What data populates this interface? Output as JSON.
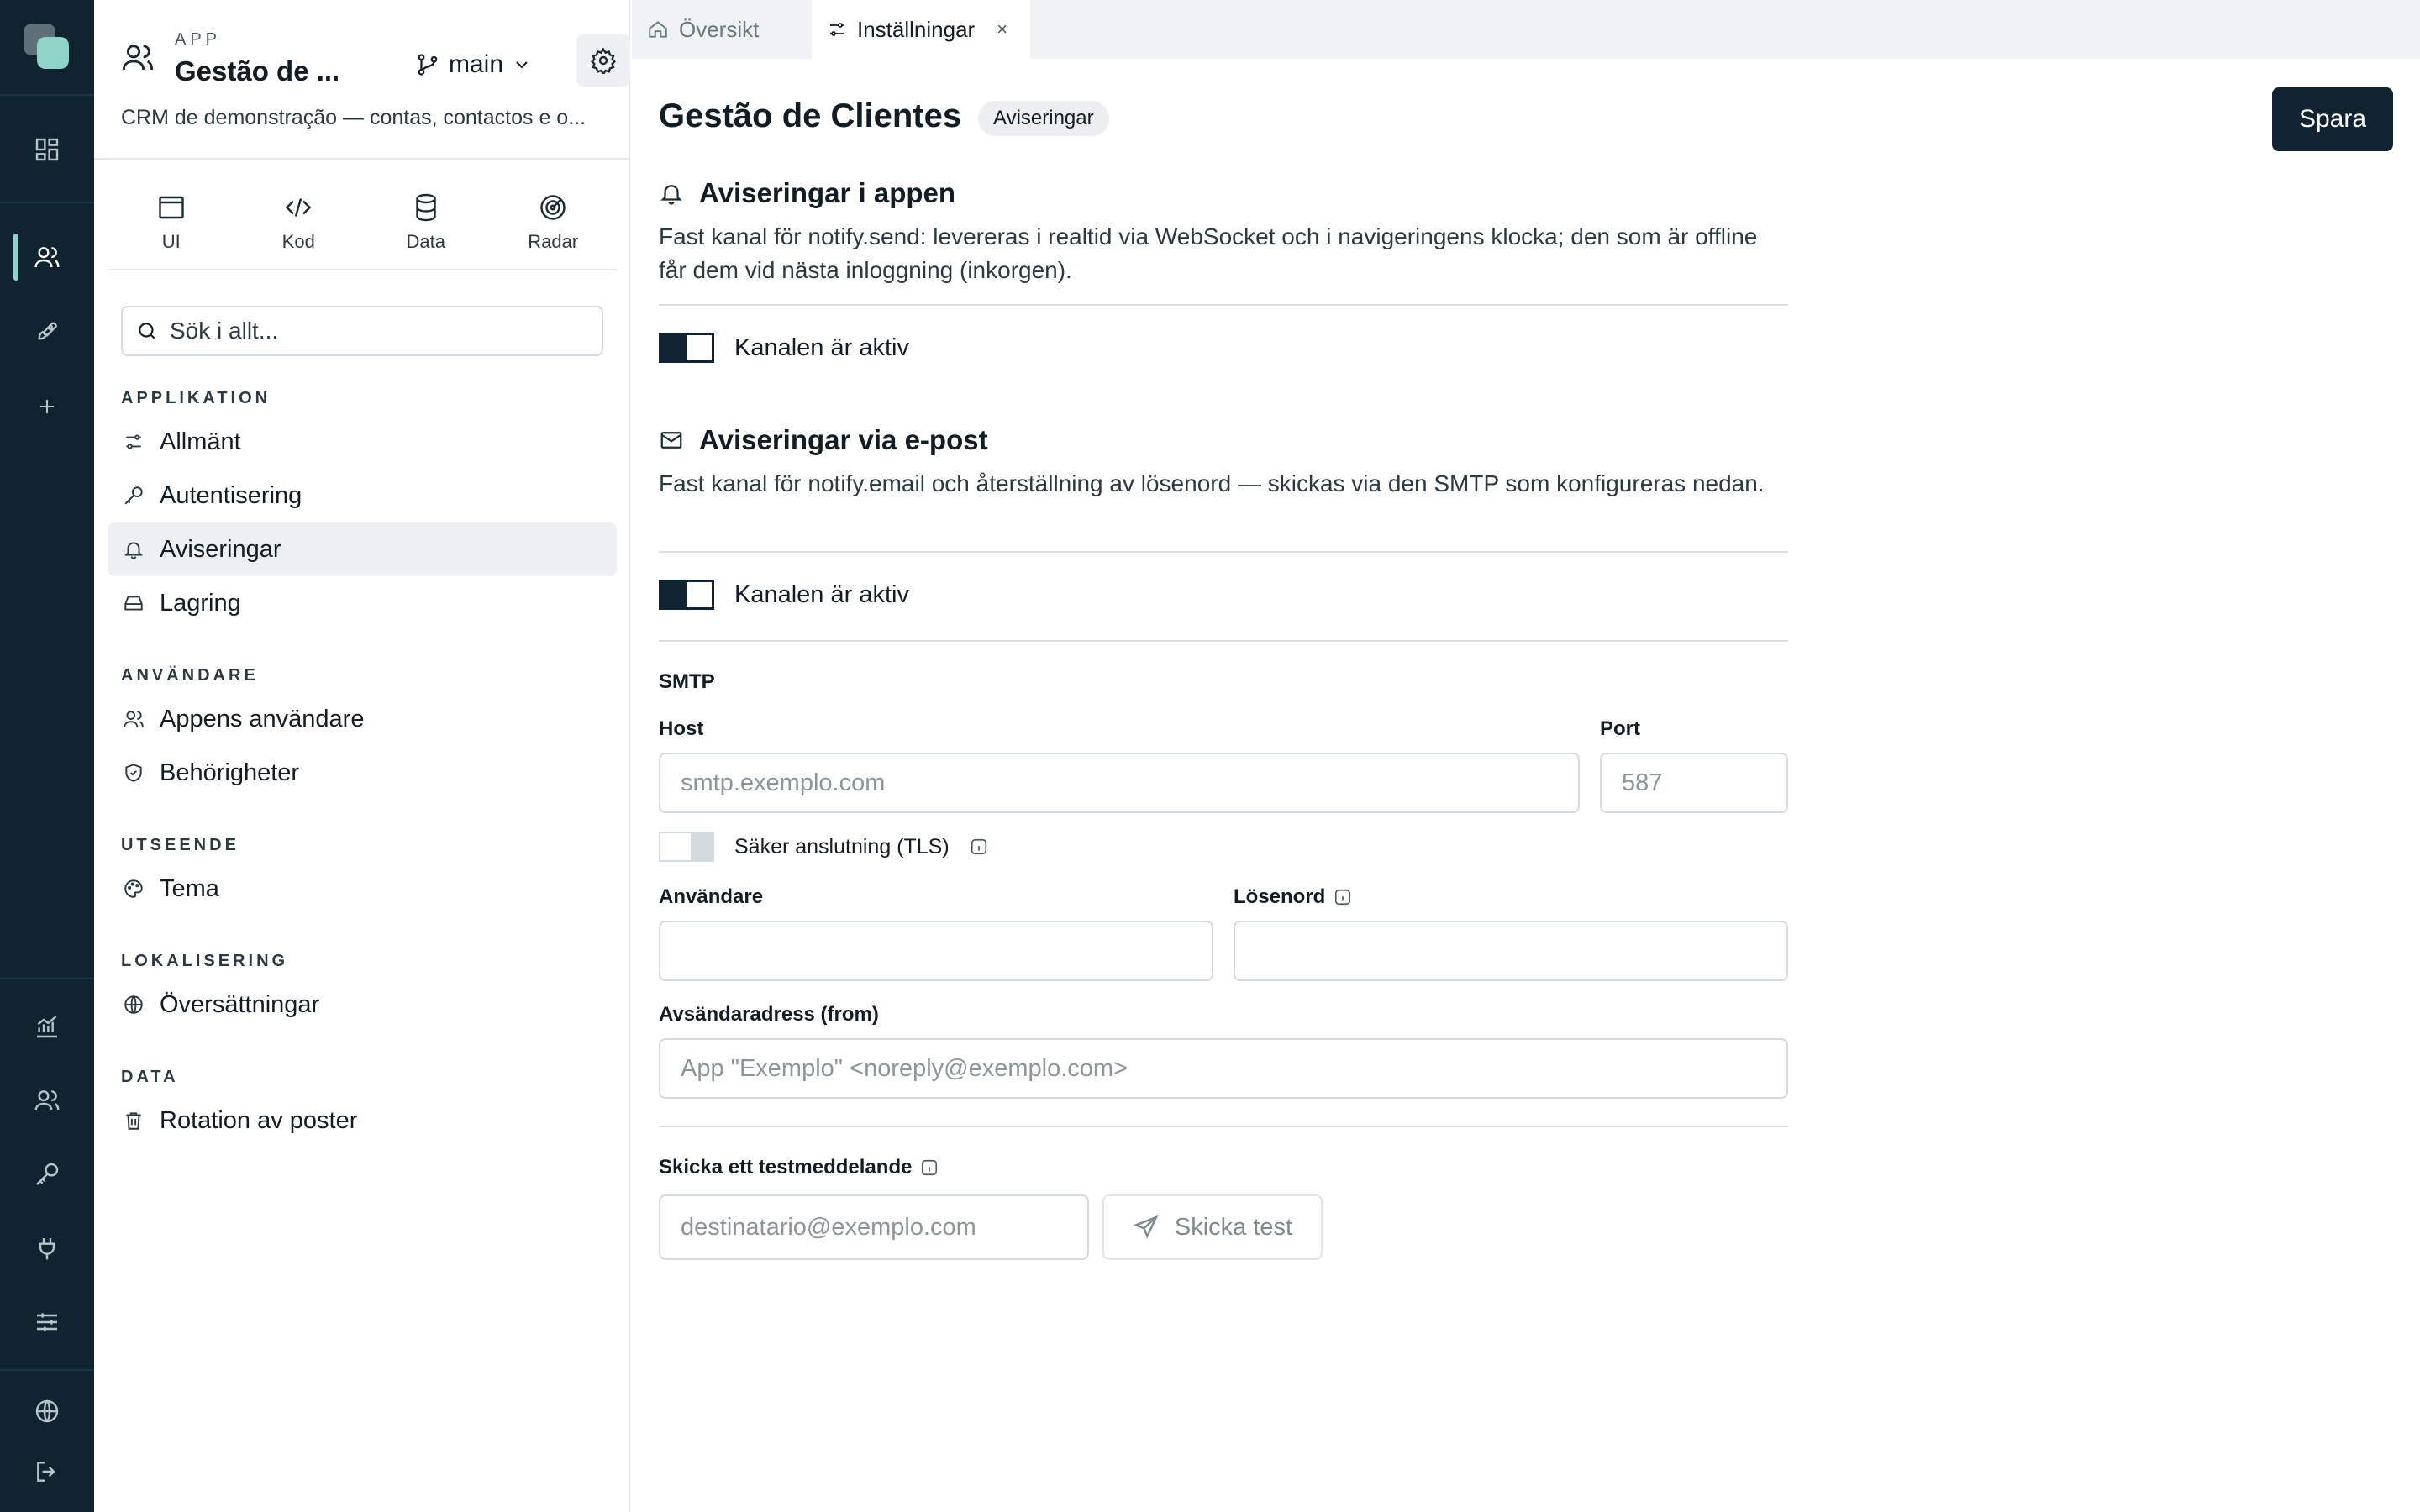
{
  "app": {
    "kicker": "APP",
    "name": "Gestão de ...",
    "branch": "main",
    "description": "CRM de demonstração — contas, contactos e o..."
  },
  "modes": [
    {
      "label": "UI",
      "icon": "window-icon"
    },
    {
      "label": "Kod",
      "icon": "code-icon"
    },
    {
      "label": "Data",
      "icon": "database-icon"
    },
    {
      "label": "Radar",
      "icon": "radar-icon"
    }
  ],
  "search": {
    "placeholder": "Sök i allt..."
  },
  "nav": {
    "applikation": {
      "title": "APPLIKATION",
      "items": [
        {
          "label": "Allmänt",
          "icon": "sliders-icon"
        },
        {
          "label": "Autentisering",
          "icon": "key-icon"
        },
        {
          "label": "Aviseringar",
          "icon": "bell-icon",
          "active": true
        },
        {
          "label": "Lagring",
          "icon": "drive-icon"
        }
      ]
    },
    "anvandare": {
      "title": "ANVÄNDARE",
      "items": [
        {
          "label": "Appens användare",
          "icon": "users-icon"
        },
        {
          "label": "Behörigheter",
          "icon": "shield-icon"
        }
      ]
    },
    "utseende": {
      "title": "UTSEENDE",
      "items": [
        {
          "label": "Tema",
          "icon": "palette-icon"
        }
      ]
    },
    "lokalisering": {
      "title": "LOKALISERING",
      "items": [
        {
          "label": "Översättningar",
          "icon": "globe-icon"
        }
      ]
    },
    "data": {
      "title": "DATA",
      "items": [
        {
          "label": "Rotation av poster",
          "icon": "trash-icon"
        }
      ]
    }
  },
  "tabs": [
    {
      "label": "Översikt",
      "icon": "home-icon"
    },
    {
      "label": "Inställningar",
      "icon": "sliders-icon",
      "close": "×"
    }
  ],
  "page": {
    "title": "Gestão de Clientes",
    "badge": "Aviseringar",
    "save_label": "Spara"
  },
  "in_app": {
    "title": "Aviseringar i appen",
    "description": "Fast kanal för notify.send: levereras i realtid via WebSocket och i navigeringens klocka; den som är offline får dem vid nästa inloggning (inkorgen).",
    "toggle_label": "Kanalen är aktiv",
    "enabled": true
  },
  "email": {
    "title": "Aviseringar via e-post",
    "description": "Fast kanal för notify.email och återställning av lösenord — skickas via den SMTP som konfigureras nedan.",
    "toggle_label": "Kanalen är aktiv",
    "enabled": true
  },
  "smtp": {
    "heading": "SMTP",
    "host_label": "Host",
    "host_placeholder": "smtp.exemplo.com",
    "port_label": "Port",
    "port_placeholder": "587",
    "tls_label": "Säker anslutning (TLS)",
    "tls_enabled": false,
    "user_label": "Användare",
    "password_label": "Lösenord",
    "from_label": "Avsändaradress (from)",
    "from_placeholder": "App \"Exemplo\" <noreply@exemplo.com>"
  },
  "test": {
    "label": "Skicka ett testmeddelande",
    "recipient_placeholder": "destinatario@exemplo.com",
    "button_label": "Skicka test"
  },
  "colors": {
    "rail_bg": "#0f2430",
    "accent": "#8fd3c9",
    "primary_button": "#0f2430"
  }
}
